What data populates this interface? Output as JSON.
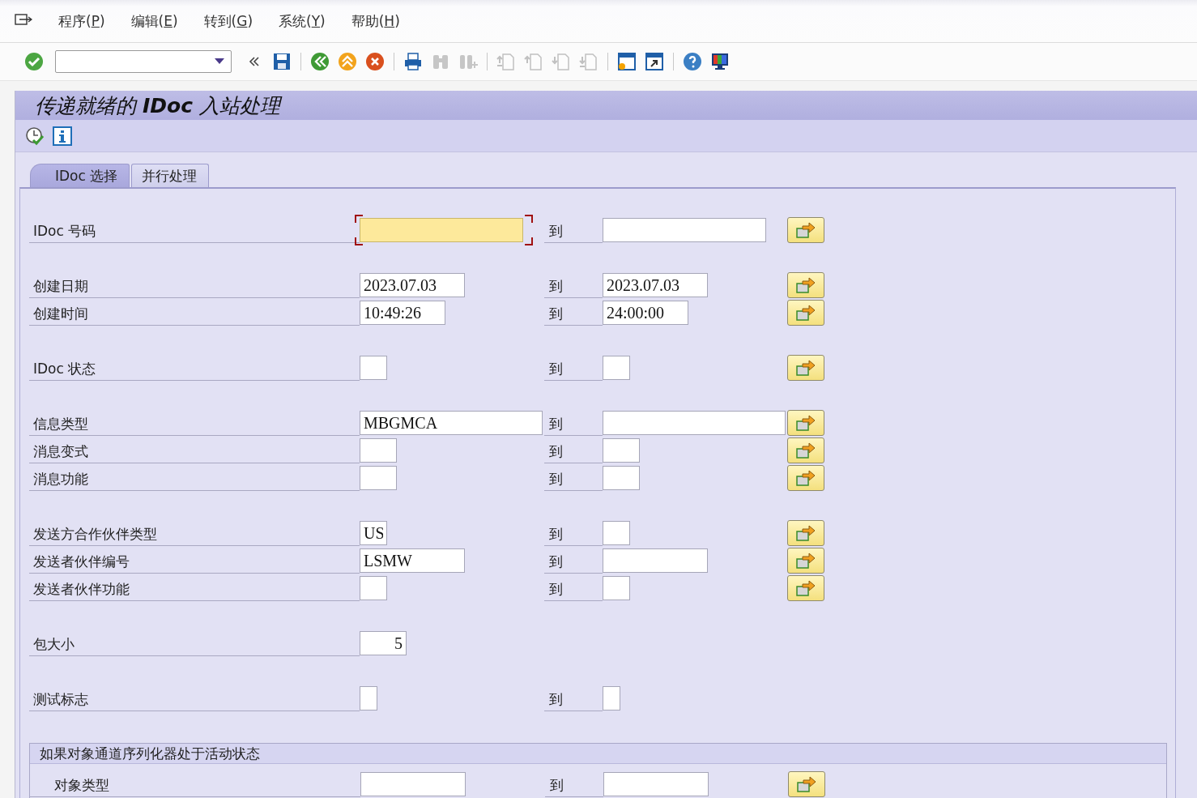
{
  "menu": [
    {
      "label": "程序(",
      "accel": "P",
      "tail": ")"
    },
    {
      "label": "编辑(",
      "accel": "E",
      "tail": ")"
    },
    {
      "label": "转到(",
      "accel": "G",
      "tail": ")"
    },
    {
      "label": "系统(",
      "accel": "Y",
      "tail": ")"
    },
    {
      "label": "帮助(",
      "accel": "H",
      "tail": ")"
    }
  ],
  "toolbar": [
    [
      {
        "kind": "enter",
        "disabled": false
      },
      {
        "kind": "command",
        "disabled": false
      },
      {
        "kind": "collapse",
        "disabled": false
      },
      {
        "kind": "save",
        "disabled": false
      }
    ],
    [
      {
        "kind": "back",
        "disabled": false
      },
      {
        "kind": "exit",
        "disabled": false
      },
      {
        "kind": "cancel",
        "disabled": false
      }
    ],
    [
      {
        "kind": "print",
        "disabled": false
      },
      {
        "kind": "find",
        "disabled": true
      },
      {
        "kind": "find-next",
        "disabled": true
      }
    ],
    [
      {
        "kind": "first-page",
        "disabled": true
      },
      {
        "kind": "prev-page",
        "disabled": true
      },
      {
        "kind": "next-page",
        "disabled": true
      },
      {
        "kind": "last-page",
        "disabled": true
      }
    ],
    [
      {
        "kind": "new-session",
        "disabled": false
      },
      {
        "kind": "shortcut",
        "disabled": false
      }
    ],
    [
      {
        "kind": "help",
        "disabled": false
      },
      {
        "kind": "layout",
        "disabled": false
      }
    ]
  ],
  "title": "传递就绪的 **IDoc** 入站处理",
  "app_toolbar": [
    {
      "kind": "execute"
    },
    {
      "kind": "info"
    }
  ],
  "tabs": [
    {
      "label": "IDoc 选择",
      "selected": true
    },
    {
      "label": "并行处理",
      "selected": false
    }
  ],
  "groups": [
    [
      {
        "label": "IDoc 号码",
        "from": {
          "kind": "number",
          "focused": true
        },
        "to_label": "到",
        "to": {
          "kind": "number",
          "focused": false
        },
        "more": true
      }
    ],
    [
      {
        "label": "创建日期",
        "from": {
          "kind": "date",
          "value": "2023.07.03",
          "focused": false
        },
        "to_label": "到",
        "to": {
          "kind": "date",
          "value": "2023.07.03",
          "focused": false
        },
        "more": true
      },
      {
        "label": "创建时间",
        "from": {
          "kind": "time",
          "value": "10:49:26",
          "focused": false
        },
        "to_label": "到",
        "to": {
          "kind": "time",
          "value": "24:00:00",
          "focused": false
        },
        "more": true
      }
    ],
    [
      {
        "label": "IDoc 状态",
        "from": {
          "kind": "tiny",
          "focused": false
        },
        "to_label": "到",
        "to": {
          "kind": "tiny",
          "focused": false
        },
        "more": true
      }
    ],
    [
      {
        "label": "信息类型",
        "from": {
          "kind": "msgtype",
          "value": "MBGMCA",
          "focused": false
        },
        "to_label": "到",
        "to": {
          "kind": "msgtype",
          "focused": false
        },
        "more": true
      },
      {
        "label": "消息变式",
        "from": {
          "kind": "small",
          "focused": false
        },
        "to_label": "到",
        "to": {
          "kind": "small",
          "focused": false
        },
        "more": true
      },
      {
        "label": "消息功能",
        "from": {
          "kind": "small",
          "focused": false
        },
        "to_label": "到",
        "to": {
          "kind": "small",
          "focused": false
        },
        "more": true
      }
    ],
    [
      {
        "label": "发送方合作伙伴类型",
        "from": {
          "kind": "tiny",
          "value": "US",
          "focused": false
        },
        "to_label": "到",
        "to": {
          "kind": "tiny",
          "focused": false
        },
        "more": true
      },
      {
        "label": "发送者伙伴编号",
        "from": {
          "kind": "partner",
          "value": "LSMW",
          "focused": false
        },
        "to_label": "到",
        "to": {
          "kind": "partner",
          "focused": false
        },
        "more": true
      },
      {
        "label": "发送者伙伴功能",
        "from": {
          "kind": "tiny",
          "focused": false
        },
        "to_label": "到",
        "to": {
          "kind": "tiny",
          "focused": false
        },
        "more": true
      }
    ],
    [
      {
        "label": "包大小",
        "from": {
          "kind": "count",
          "value": "5",
          "focused": false
        }
      }
    ],
    [
      {
        "label": "测试标志",
        "from": {
          "kind": "flag",
          "focused": false
        },
        "to_label": "到",
        "to": {
          "kind": "flag",
          "focused": false
        }
      }
    ]
  ],
  "section": {
    "title": "如果对象通道序列化器处于活动状态",
    "rows": [
      {
        "label": "对象类型",
        "from": {
          "kind": "partner",
          "focused": false
        },
        "to_label": "到",
        "to": {
          "kind": "partner",
          "focused": false
        },
        "more": true
      }
    ]
  }
}
